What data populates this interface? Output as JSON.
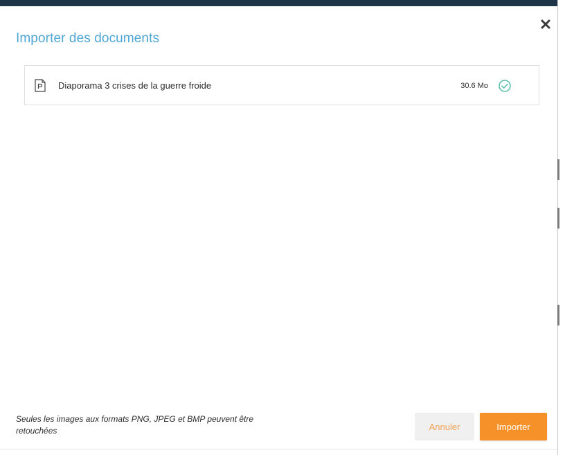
{
  "dialog": {
    "title": "Importer des documents",
    "close_icon": "close-icon"
  },
  "files": [
    {
      "name": "Diaporama 3 crises de la guerre froide",
      "size": "30.6 Mo",
      "type_icon": "file-document-icon",
      "status_icon": "check-circle-icon"
    }
  ],
  "footer": {
    "note": "Seules les images aux formats PNG, JPEG et BMP peuvent être retouchées",
    "cancel_label": "Annuler",
    "import_label": "Importer"
  },
  "colors": {
    "title": "#4ea6d4",
    "accent_orange": "#f59128",
    "cancel_text": "#f0a050",
    "cancel_bg": "#f0f0f0",
    "success": "#5bbfae",
    "top_bar": "#1e3547"
  }
}
